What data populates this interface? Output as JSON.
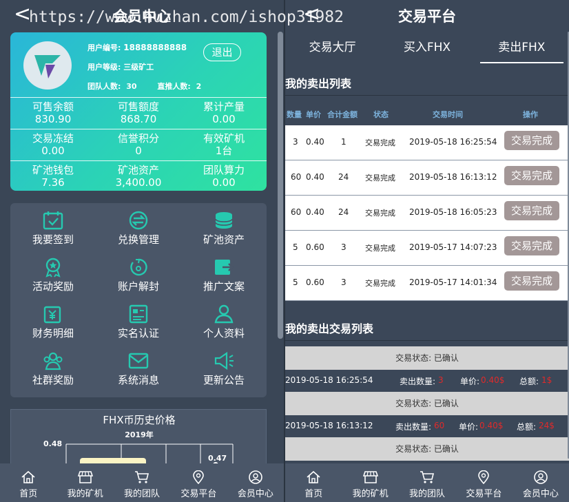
{
  "watermark": "https://www.huzhan.com/ishop31982",
  "left": {
    "title": "会员中心",
    "back_glyph": "<",
    "user": {
      "id_label": "用户编号:",
      "id_value": "18888888888",
      "level_label": "用户等级:",
      "level_value": "三级矿工",
      "team_label": "团队人数:",
      "team_value": "30",
      "direct_label": "直推人数:",
      "direct_value": "2",
      "logout": "退出"
    },
    "stats": [
      [
        {
          "label": "可售余额",
          "value": "830.90"
        },
        {
          "label": "可售额度",
          "value": "868.70"
        },
        {
          "label": "累计产量",
          "value": "0.00"
        }
      ],
      [
        {
          "label": "交易冻结",
          "value": "0.00"
        },
        {
          "label": "信誉积分",
          "value": "0"
        },
        {
          "label": "有效矿机",
          "value": "1台"
        }
      ],
      [
        {
          "label": "矿池钱包",
          "value": "7.36"
        },
        {
          "label": "矿池资产",
          "value": "3,400.00"
        },
        {
          "label": "团队算力",
          "value": "0.00"
        }
      ]
    ],
    "menu": [
      {
        "label": "我要签到",
        "icon": "calendar-check-icon"
      },
      {
        "label": "兑换管理",
        "icon": "exchange-icon"
      },
      {
        "label": "矿池资产",
        "icon": "coin-stack-icon"
      },
      {
        "label": "活动奖励",
        "icon": "medal-icon"
      },
      {
        "label": "账户解封",
        "icon": "unlock-icon"
      },
      {
        "label": "推广文案",
        "icon": "share-icon"
      },
      {
        "label": "财务明细",
        "icon": "finance-icon"
      },
      {
        "label": "实名认证",
        "icon": "id-card-icon"
      },
      {
        "label": "个人资料",
        "icon": "user-icon"
      },
      {
        "label": "社群奖励",
        "icon": "group-icon"
      },
      {
        "label": "系统消息",
        "icon": "mail-icon"
      },
      {
        "label": "更新公告",
        "icon": "megaphone-icon"
      }
    ],
    "chart_data": {
      "type": "line",
      "title": "FHX币历史价格",
      "subtitle": "2019年",
      "labels": [
        "0.48",
        "0.47"
      ]
    }
  },
  "right": {
    "title": "交易平台",
    "back_glyph": "<",
    "tabs": [
      "交易大厅",
      "买入FHX",
      "卖出FHX"
    ],
    "active_tab": 2,
    "list_title": "我的卖出列表",
    "columns": [
      "数量",
      "单价",
      "合计金额",
      "状态",
      "交易时间",
      "操作"
    ],
    "rows": [
      {
        "qty": "3",
        "price": "0.40",
        "total": "1",
        "status": "交易完成",
        "time": "2019-05-18 16:25:54",
        "action": "交易完成"
      },
      {
        "qty": "60",
        "price": "0.40",
        "total": "24",
        "status": "交易完成",
        "time": "2019-05-18 16:13:12",
        "action": "交易完成"
      },
      {
        "qty": "60",
        "price": "0.40",
        "total": "24",
        "status": "交易完成",
        "time": "2019-05-18 16:05:23",
        "action": "交易完成"
      },
      {
        "qty": "5",
        "price": "0.60",
        "total": "3",
        "status": "交易完成",
        "time": "2019-05-17 14:07:23",
        "action": "交易完成"
      },
      {
        "qty": "5",
        "price": "0.60",
        "total": "3",
        "status": "交易完成",
        "time": "2019-05-17 14:01:34",
        "action": "交易完成"
      }
    ],
    "trade_title": "我的卖出交易列表",
    "trades": [
      {
        "status": "交易状态: 已确认",
        "time": "2019-05-18 16:25:54",
        "qty_label": "卖出数量:",
        "qty": "3",
        "price_label": "单价:",
        "price": "0.40$",
        "total_label": "总额:",
        "total": "1$"
      },
      {
        "status": "交易状态: 已确认",
        "time": "2019-05-18 16:13:12",
        "qty_label": "卖出数量:",
        "qty": "60",
        "price_label": "单价:",
        "price": "0.40$",
        "total_label": "总额:",
        "total": "24$"
      },
      {
        "status": "交易状态: 已确认"
      }
    ]
  },
  "tabbar": [
    {
      "label": "首页",
      "icon": "home-icon"
    },
    {
      "label": "我的矿机",
      "icon": "shop-icon"
    },
    {
      "label": "我的团队",
      "icon": "cart-icon"
    },
    {
      "label": "交易平台",
      "icon": "location-icon"
    },
    {
      "label": "会员中心",
      "icon": "person-icon"
    }
  ],
  "colors": {
    "accent_teal": "#2bd3b6",
    "accent_cyan": "#2ab6d8",
    "icon_teal": "#26c9b0",
    "button_gray": "#a39797",
    "price_red": "#e02a2a"
  }
}
